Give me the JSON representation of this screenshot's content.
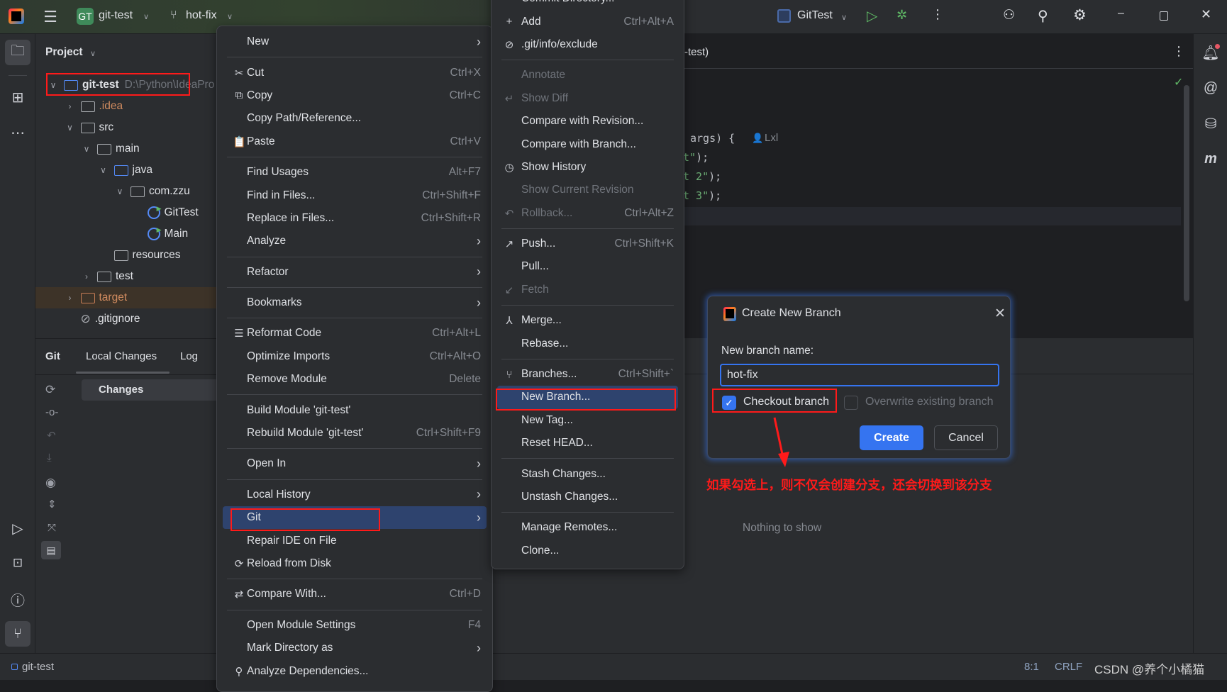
{
  "titlebar": {
    "project_badge": "GT",
    "project_name": "git-test",
    "branch": "hot-fix",
    "run_config": "GitTest",
    "colors": {
      "badge": "#3f8a5a",
      "run": "#5fb865",
      "debug": "#5fb865"
    }
  },
  "left_strip": {
    "icons": [
      "folder-icon",
      "structure-icon",
      "more-icon",
      "run-icon",
      "terminal-icon",
      "problems-icon",
      "git-icon"
    ]
  },
  "right_strip": {
    "icons": [
      "notifications-icon",
      "ai-assistant-icon",
      "database-icon",
      "maven-icon"
    ]
  },
  "project": {
    "title": "Project",
    "tree": [
      {
        "label": "git-test",
        "path": "D:\\Python\\IdeaPro",
        "depth": 0,
        "chevron": "down",
        "icon": "module",
        "bold": true
      },
      {
        "label": ".idea",
        "depth": 1,
        "chevron": "right",
        "icon": "folder",
        "color": "#d08b5f"
      },
      {
        "label": "src",
        "depth": 1,
        "chevron": "down",
        "icon": "folder"
      },
      {
        "label": "main",
        "depth": 2,
        "chevron": "down",
        "icon": "folder"
      },
      {
        "label": "java",
        "depth": 3,
        "chevron": "down",
        "icon": "folder-blue"
      },
      {
        "label": "com.zzu",
        "depth": 4,
        "chevron": "down",
        "icon": "package"
      },
      {
        "label": "GitTest",
        "depth": 5,
        "chevron": "",
        "icon": "class"
      },
      {
        "label": "Main",
        "depth": 5,
        "chevron": "",
        "icon": "class"
      },
      {
        "label": "resources",
        "depth": 3,
        "chevron": "",
        "icon": "resources"
      },
      {
        "label": "test",
        "depth": 2,
        "chevron": "right",
        "icon": "folder"
      },
      {
        "label": "target",
        "depth": 1,
        "chevron": "right",
        "icon": "folder-orange",
        "color": "#d08b5f",
        "highlight": true
      },
      {
        "label": ".gitignore",
        "depth": 1,
        "chevron": "",
        "icon": "ignore"
      }
    ]
  },
  "git_window": {
    "tabs": [
      "Git",
      "Local Changes",
      "Log"
    ],
    "active_tab": "Local Changes",
    "changes_label": "Changes"
  },
  "editor": {
    "tab_fragment": "-test)",
    "lines": [
      {
        "code": "args) {",
        "author": "Lxl"
      },
      {
        "string": "t\"",
        "code": ");"
      },
      {
        "string": "t 2\"",
        "code": ");"
      },
      {
        "string": "t 3\"",
        "code": ");"
      }
    ],
    "nothing_to_show": "Nothing to show"
  },
  "context_menu": {
    "items": [
      {
        "label": "New",
        "submenu": true
      },
      {
        "sep": true
      },
      {
        "label": "Cut",
        "shortcut": "Ctrl+X",
        "icon": "✂",
        "icon_name": "cut-icon"
      },
      {
        "label": "Copy",
        "shortcut": "Ctrl+C",
        "icon": "⧉",
        "icon_name": "copy-icon"
      },
      {
        "label": "Copy Path/Reference..."
      },
      {
        "label": "Paste",
        "shortcut": "Ctrl+V",
        "icon": "📋",
        "icon_name": "paste-icon"
      },
      {
        "sep": true
      },
      {
        "label": "Find Usages",
        "shortcut": "Alt+F7"
      },
      {
        "label": "Find in Files...",
        "shortcut": "Ctrl+Shift+F"
      },
      {
        "label": "Replace in Files...",
        "shortcut": "Ctrl+Shift+R"
      },
      {
        "label": "Analyze",
        "submenu": true
      },
      {
        "sep": true
      },
      {
        "label": "Refactor",
        "submenu": true
      },
      {
        "sep": true
      },
      {
        "label": "Bookmarks",
        "submenu": true
      },
      {
        "sep": true
      },
      {
        "label": "Reformat Code",
        "shortcut": "Ctrl+Alt+L",
        "icon": "☰",
        "icon_name": "reformat-icon"
      },
      {
        "label": "Optimize Imports",
        "shortcut": "Ctrl+Alt+O"
      },
      {
        "label": "Remove Module",
        "shortcut": "Delete"
      },
      {
        "sep": true
      },
      {
        "label": "Build Module 'git-test'"
      },
      {
        "label": "Rebuild Module 'git-test'",
        "shortcut": "Ctrl+Shift+F9"
      },
      {
        "sep": true
      },
      {
        "label": "Open In",
        "submenu": true
      },
      {
        "sep": true
      },
      {
        "label": "Local History",
        "submenu": true
      },
      {
        "label": "Git",
        "submenu": true,
        "highlighted": true
      },
      {
        "label": "Repair IDE on File"
      },
      {
        "label": "Reload from Disk",
        "icon": "⟳",
        "icon_name": "reload-icon"
      },
      {
        "sep": true
      },
      {
        "label": "Compare With...",
        "shortcut": "Ctrl+D",
        "icon": "⇄",
        "icon_name": "compare-icon"
      },
      {
        "sep": true
      },
      {
        "label": "Open Module Settings",
        "shortcut": "F4"
      },
      {
        "label": "Mark Directory as",
        "submenu": true
      },
      {
        "label": "Analyze Dependencies...",
        "icon": "⚲",
        "icon_name": "analyze-icon"
      }
    ]
  },
  "git_menu": {
    "items": [
      {
        "label": "Commit Directory..."
      },
      {
        "label": "Add",
        "shortcut": "Ctrl+Alt+A",
        "icon": "+",
        "icon_name": "add-icon"
      },
      {
        "label": ".git/info/exclude",
        "icon": "⊘",
        "icon_name": "ignore-icon"
      },
      {
        "sep": true
      },
      {
        "label": "Annotate",
        "disabled": true
      },
      {
        "label": "Show Diff",
        "disabled": true,
        "icon": "↵",
        "icon_name": "diff-icon"
      },
      {
        "label": "Compare with Revision..."
      },
      {
        "label": "Compare with Branch..."
      },
      {
        "label": "Show History",
        "icon": "◷",
        "icon_name": "history-icon"
      },
      {
        "label": "Show Current Revision",
        "disabled": true
      },
      {
        "label": "Rollback...",
        "shortcut": "Ctrl+Alt+Z",
        "disabled": true,
        "icon": "↶",
        "icon_name": "rollback-icon"
      },
      {
        "sep": true
      },
      {
        "label": "Push...",
        "shortcut": "Ctrl+Shift+K",
        "icon": "↗",
        "icon_name": "push-icon"
      },
      {
        "label": "Pull..."
      },
      {
        "label": "Fetch",
        "disabled": true,
        "icon": "↙",
        "icon_name": "fetch-icon"
      },
      {
        "sep": true
      },
      {
        "label": "Merge...",
        "icon": "⅄",
        "icon_name": "merge-icon"
      },
      {
        "label": "Rebase..."
      },
      {
        "sep": true
      },
      {
        "label": "Branches...",
        "shortcut": "Ctrl+Shift+`",
        "icon": "⑂",
        "icon_name": "branch-icon"
      },
      {
        "label": "New Branch...",
        "highlighted": true
      },
      {
        "label": "New Tag..."
      },
      {
        "label": "Reset HEAD..."
      },
      {
        "sep": true
      },
      {
        "label": "Stash Changes..."
      },
      {
        "label": "Unstash Changes..."
      },
      {
        "sep": true
      },
      {
        "label": "Manage Remotes..."
      },
      {
        "label": "Clone..."
      }
    ]
  },
  "dialog": {
    "title": "Create New Branch",
    "field_label": "New branch name:",
    "field_value": "hot-fix",
    "checkout_label": "Checkout branch",
    "checkout_checked": true,
    "overwrite_label": "Overwrite existing branch",
    "overwrite_checked": false,
    "create_label": "Create",
    "cancel_label": "Cancel",
    "accent": "#3574f0"
  },
  "annotation": {
    "text": "如果勾选上，则不仅会创建分支，还会切换到该分支",
    "color": "#ff1a1a"
  },
  "statusbar": {
    "project": "git-test",
    "position": "8:1",
    "line_ending": "CRLF",
    "watermark": "CSDN @养个小橘猫"
  }
}
